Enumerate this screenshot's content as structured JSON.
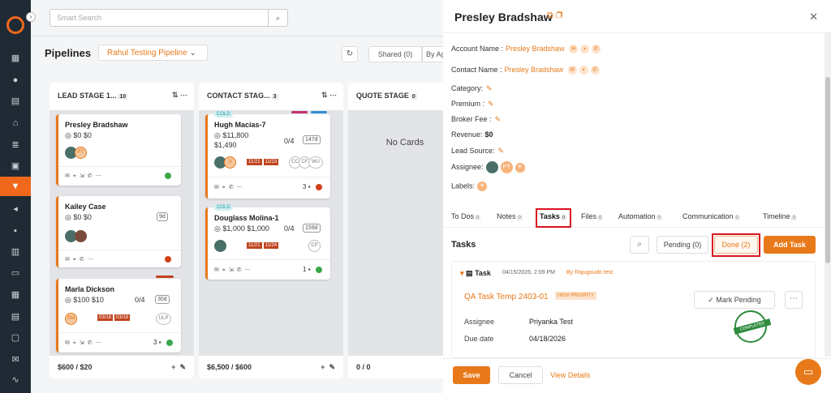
{
  "search": {
    "placeholder": "Smart Search"
  },
  "page": {
    "title": "Pipelines",
    "pipeline": "Rahul Testing Pipeline",
    "shared": "Shared (0)",
    "by_agent": "By Ag"
  },
  "columns": [
    {
      "title": "LEAD STAGE 1...",
      "count": "10",
      "footer_total": "$600 / $20"
    },
    {
      "title": "CONTACT STAG...",
      "count": "3",
      "footer_total": "$6,500 / $600"
    },
    {
      "title": "QUOTE STAGE",
      "count": "0",
      "footer_total": "0 / 0",
      "empty_text": "No Cards"
    }
  ],
  "cards": [
    {
      "name": "Presley Bradshaw",
      "amount": "$0 $0",
      "avatar": "PT"
    },
    {
      "name": "Kailey Case",
      "amount": "$0 $0",
      "tag": "9d"
    },
    {
      "name": "Marla Dickson",
      "amount": "$100 $10",
      "ratio": "0/4",
      "tag": "30d",
      "avatar": "RM",
      "dates": [
        "03/18",
        "03/18"
      ],
      "avatar2": "ULP",
      "count": "3"
    },
    {
      "name": "Hugh Macias-7",
      "badge": "COLD",
      "amount": "$11,800",
      "sub": "$1,490",
      "ratio": "0/4",
      "tag": "147d",
      "dates": [
        "11/21",
        "11/23"
      ],
      "initials": [
        "CC",
        "CF",
        "WU"
      ],
      "avatar": "JI",
      "count": "3"
    },
    {
      "name": "Douglass Molina-1",
      "badge": "COLD",
      "amount": "$1,000 $1,000",
      "ratio": "0/4",
      "tag": "159d",
      "dates": [
        "11/21",
        "11/24"
      ],
      "avatar2": "CP",
      "count": "1"
    }
  ],
  "panel": {
    "title": "Presley Bradshaw",
    "fields": {
      "account_label": "Account Name :",
      "account_value": "Presley Bradshaw",
      "contact_label": "Contact Name :",
      "contact_value": "Presley Bradshaw",
      "category_label": "Category:",
      "premium_label": "Premium :",
      "broker_label": "Broker Fee :",
      "revenue_label": "Revenue:",
      "revenue_value": "$0",
      "lead_source_label": "Lead Source:",
      "assignee_label": "Assignee:",
      "assignee_initials": "PT",
      "labels_label": "Labels:"
    },
    "tabs": [
      {
        "label": "To Dos",
        "count": "0"
      },
      {
        "label": "Notes",
        "count": "0"
      },
      {
        "label": "Tasks",
        "count": "0"
      },
      {
        "label": "Files",
        "count": "0"
      },
      {
        "label": "Automation",
        "count": "0"
      },
      {
        "label": "Communication",
        "count": "0"
      },
      {
        "label": "Timeline",
        "count": "0"
      }
    ],
    "tasks_heading": "Tasks",
    "pending": "Pending (0)",
    "done": "Done (2)",
    "add_task": "Add Task",
    "task": {
      "type": "Task",
      "datetime": "04/15/2026, 2:09 PM",
      "by": "By Rajugoudo test",
      "name": "QA Task Temp 2403-01",
      "priority": "HIGH PRIORITY",
      "mark_pending": "Mark Pending",
      "stamp": "COMPLETED",
      "assignee_label": "Assignee",
      "assignee_value": "Priyanka Test",
      "due_label": "Due date",
      "due_value": "04/18/2026"
    },
    "footer": {
      "save": "Save",
      "cancel": "Cancel",
      "view_details": "View Details"
    }
  },
  "colors": {
    "accent": "#e8791a",
    "rail": "#1f2a35",
    "highlight": "#d9121f"
  }
}
